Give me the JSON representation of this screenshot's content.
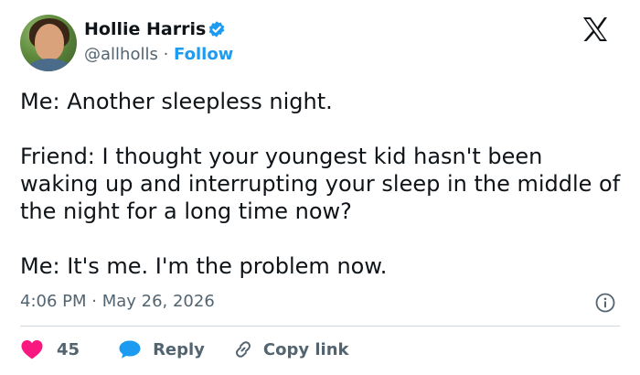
{
  "author": {
    "name": "Hollie Harris",
    "handle": "@allholls",
    "separator": "·",
    "follow_label": "Follow",
    "verified": true,
    "avatar_icon": "profile-photo"
  },
  "platform_logo": "x-logo",
  "tweet": {
    "paragraphs": [
      "Me: Another sleepless night.",
      "Friend: I thought your youngest kid hasn't been waking up and interrupting your sleep in the middle of the night for a long time now?",
      "Me: It's me. I'm the problem now."
    ],
    "timestamp": "4:06 PM · May 26, 2026"
  },
  "actions": {
    "like_count": "45",
    "reply_label": "Reply",
    "copy_link_label": "Copy link"
  },
  "colors": {
    "accent": "#1d9bf0",
    "like": "#f91880",
    "text": "#0f1419",
    "muted": "#536471",
    "divider": "#cfd9de"
  }
}
